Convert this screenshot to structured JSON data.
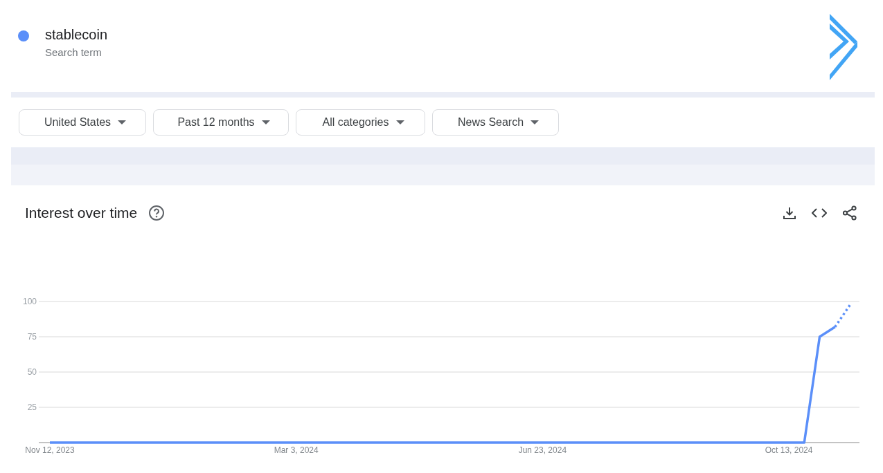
{
  "search_term": {
    "term": "stablecoin",
    "subtitle": "Search term",
    "color": "#5b8ff9"
  },
  "filters": [
    {
      "label": "United States"
    },
    {
      "label": "Past 12 months"
    },
    {
      "label": "All categories"
    },
    {
      "label": "News Search"
    }
  ],
  "interest_over_time": {
    "title": "Interest over time",
    "last_point_partial": true,
    "chart_data": {
      "type": "line",
      "categories": [
        "Nov 12, 2023",
        null,
        null,
        null,
        null,
        null,
        null,
        null,
        null,
        null,
        null,
        null,
        null,
        null,
        null,
        null,
        "Mar 3, 2024",
        null,
        null,
        null,
        null,
        null,
        null,
        null,
        null,
        null,
        null,
        null,
        null,
        null,
        null,
        null,
        "Jun 23, 2024",
        null,
        null,
        null,
        null,
        null,
        null,
        null,
        null,
        null,
        null,
        null,
        null,
        null,
        null,
        null,
        "Oct 13, 2024",
        null,
        null,
        null,
        null
      ],
      "series": [
        {
          "color": "#5b8ff9",
          "values": [
            0,
            0,
            0,
            0,
            0,
            0,
            0,
            0,
            0,
            0,
            0,
            0,
            0,
            0,
            0,
            0,
            0,
            0,
            0,
            0,
            0,
            0,
            0,
            0,
            0,
            0,
            0,
            0,
            0,
            0,
            0,
            0,
            0,
            0,
            0,
            0,
            0,
            0,
            0,
            0,
            0,
            0,
            0,
            0,
            0,
            0,
            0,
            0,
            0,
            0,
            75,
            82,
            98
          ]
        }
      ],
      "ylim": [
        0,
        100
      ],
      "yticks": [
        25,
        50,
        75,
        100
      ],
      "grid": true
    }
  }
}
